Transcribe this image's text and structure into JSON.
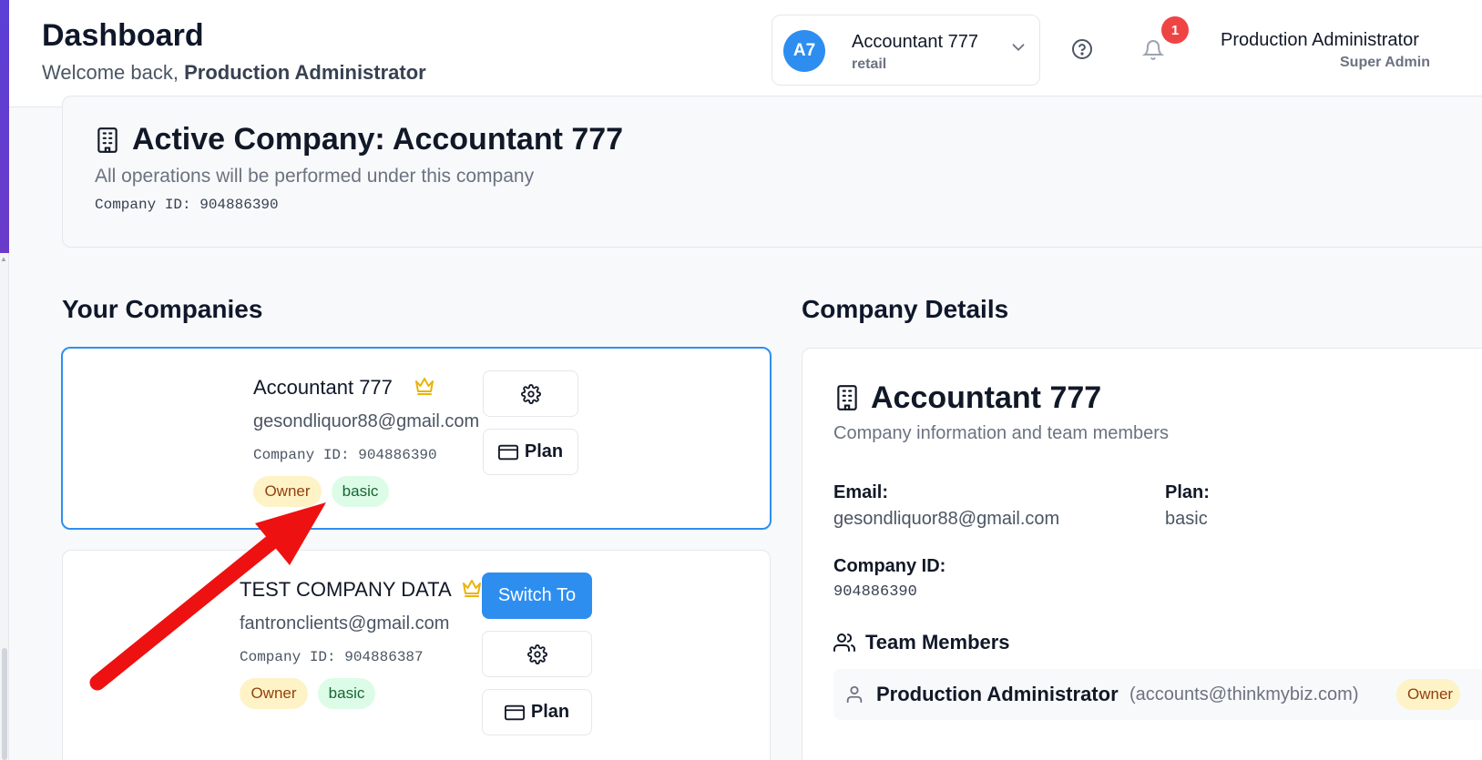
{
  "header": {
    "title": "Dashboard",
    "welcome_prefix": "Welcome back,",
    "welcome_user": "Production Administrator"
  },
  "company_switcher": {
    "initials": "A7",
    "name": "Accountant 777",
    "type": "retail"
  },
  "notifications": {
    "count": "1"
  },
  "user": {
    "name": "Production Administrator",
    "role": "Super Admin"
  },
  "active_company": {
    "title": "Active Company: Accountant 777",
    "subtitle": "All operations will be performed under this company",
    "id_text": "Company ID: 904886390"
  },
  "your_companies": {
    "title": "Your Companies",
    "items": [
      {
        "name": "Accountant 777",
        "email": "gesondliquor88@gmail.com",
        "id_text": "Company ID: 904886390",
        "role": "Owner",
        "plan": "basic",
        "plan_button": "Plan"
      },
      {
        "name": "TEST COMPANY DATA",
        "email": "fantronclients@gmail.com",
        "id_text": "Company ID: 904886387",
        "role": "Owner",
        "plan": "basic",
        "switch_button": "Switch To",
        "plan_button": "Plan"
      }
    ]
  },
  "company_details": {
    "section_title": "Company Details",
    "name": "Accountant 777",
    "subtitle": "Company information and team members",
    "email_label": "Email:",
    "email": "gesondliquor88@gmail.com",
    "plan_label": "Plan:",
    "plan": "basic",
    "id_label": "Company ID:",
    "id": "904886390",
    "team_title": "Team Members",
    "members": [
      {
        "name": "Production Administrator",
        "email": "(accounts@thinkmybiz.com)",
        "role": "Owner"
      }
    ]
  },
  "colors": {
    "accent": "#2d8ef0",
    "owner_badge_bg": "#fef3c7",
    "plan_badge_bg": "#dcfce7",
    "notification_badge": "#ef4444",
    "annotation_arrow": "#ee1111"
  },
  "icons": [
    "building-icon",
    "crown-icon",
    "gear-icon",
    "credit-card-icon",
    "help-icon",
    "bell-icon",
    "chevron-down-icon",
    "users-icon",
    "user-icon"
  ]
}
